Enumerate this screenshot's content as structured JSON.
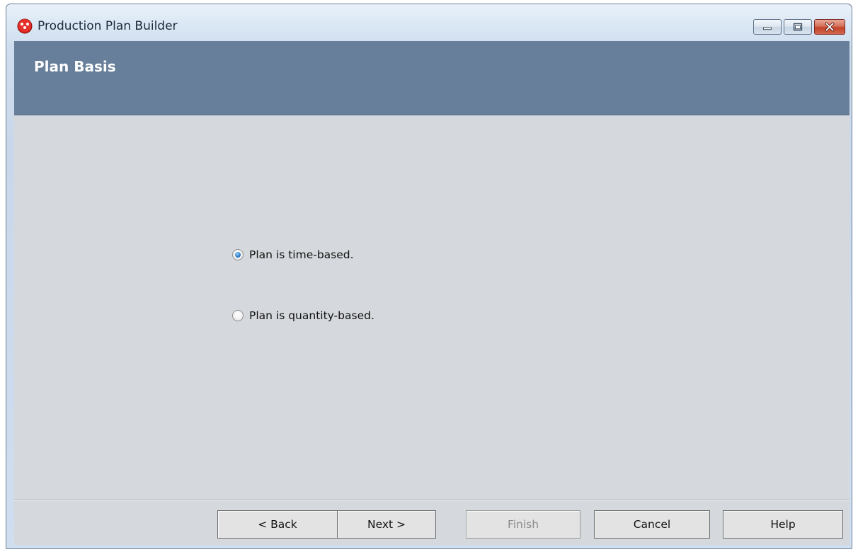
{
  "window": {
    "title": "Production Plan Builder",
    "app_icon": "red-dots-icon",
    "minimize_icon": "minimize-icon",
    "maximize_icon": "maximize-icon",
    "close_icon": "close-icon"
  },
  "header": {
    "title": "Plan Basis"
  },
  "options": [
    {
      "label": "Plan is time-based.",
      "selected": true
    },
    {
      "label": "Plan is quantity-based.",
      "selected": false
    }
  ],
  "footer": {
    "back_label": "< Back",
    "next_label": "Next >",
    "finish_label": "Finish",
    "cancel_label": "Cancel",
    "help_label": "Help",
    "finish_enabled": false
  },
  "colors": {
    "header_banner": "#677f9a",
    "client_background": "#d5d8dc",
    "radio_selected_accent": "#2f7fc8",
    "close_button": "#c24228"
  }
}
